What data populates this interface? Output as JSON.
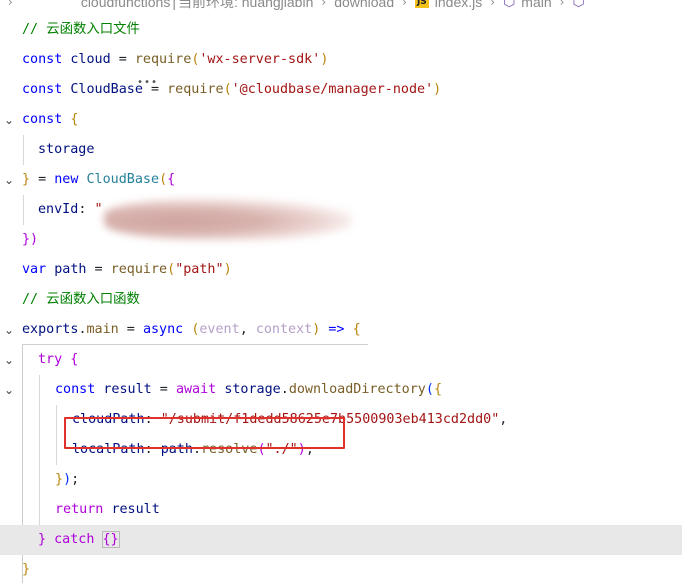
{
  "breadcrumb": {
    "segments": [
      "cloudfunctions",
      "当前环境: huangjiabin",
      "download",
      "index.js",
      "main"
    ],
    "file_badge": "JS",
    "icons": [
      "chevron-right-icon",
      "js-file-icon",
      "cube-icon"
    ]
  },
  "code": {
    "comment1": "// 云函数入口文件",
    "l2_const": "const",
    "l2_var": "cloud",
    "l2_eq": " = ",
    "l2_fn": "require",
    "l2_open": "(",
    "l2_str": "'wx-server-sdk'",
    "l2_close": ")",
    "l3_const": "const",
    "l3_var": "CloudBase",
    "l3_eq": " = ",
    "l3_fn": "require",
    "l3_open": "(",
    "l3_str": "'@cloudbase/manager-node'",
    "l3_close": ")",
    "l4_const": "const",
    "l4_brace": "{",
    "l5_prop": "storage",
    "l6_brace": "}",
    "l6_eq": " = ",
    "l6_new": "new",
    "l6_cls": "CloudBase",
    "l6_open": "(",
    "l6_brace2": "{",
    "l7_prop": "envId",
    "l7_colon": ": ",
    "l7_str": "\"",
    "l8_close": "})",
    "l9_var_kw": "var",
    "l9_var": "path",
    "l9_eq": " = ",
    "l9_fn": "require",
    "l9_open": "(",
    "l9_str": "\"path\"",
    "l9_close": ")",
    "comment2": "// 云函数入口函数",
    "l11_obj": "exports",
    "l11_dot": ".",
    "l11_fn": "main",
    "l11_eq": " = ",
    "l11_async": "async",
    "l11_paren_open": "(",
    "l11_p1": "event",
    "l11_comma": ", ",
    "l11_p2": "context",
    "l11_paren_close": ")",
    "l11_arrow": " => ",
    "l11_brace": "{",
    "l12_try": "try",
    "l12_brace": "{",
    "l13_const": "const",
    "l13_var": "result",
    "l13_eq": " = ",
    "l13_await": "await",
    "l13_obj": "storage",
    "l13_dot": ".",
    "l13_fn": "downloadDirectory",
    "l13_open": "(",
    "l13_brace": "{",
    "l14_prop": "cloudPath",
    "l14_colon": ": ",
    "l14_str": "\"/submit/f1dedd58625e7b5500903eb413cd2dd0\"",
    "l14_comma": ",",
    "l15_prop": "localPath",
    "l15_colon": ": ",
    "l15_obj": "path",
    "l15_dot": ".",
    "l15_fn": "resolve",
    "l15_open": "(",
    "l15_str": "\"./\"",
    "l15_close": ")",
    "l15_comma": ",",
    "l16_close_brace": "}",
    "l16_close_paren": ")",
    "l16_semi": ";",
    "l17_return": "return",
    "l17_var": "result",
    "l18_brace": "}",
    "l18_catch": "catch",
    "l18_empty": "{}",
    "l19_brace": "}"
  },
  "colors": {
    "keyword": "#0000ff",
    "string": "#a31515",
    "comment": "#008000",
    "function": "#795e26",
    "class": "#267f99",
    "highlight_box": "#e0322b",
    "current_line": "#e8e8e8"
  }
}
